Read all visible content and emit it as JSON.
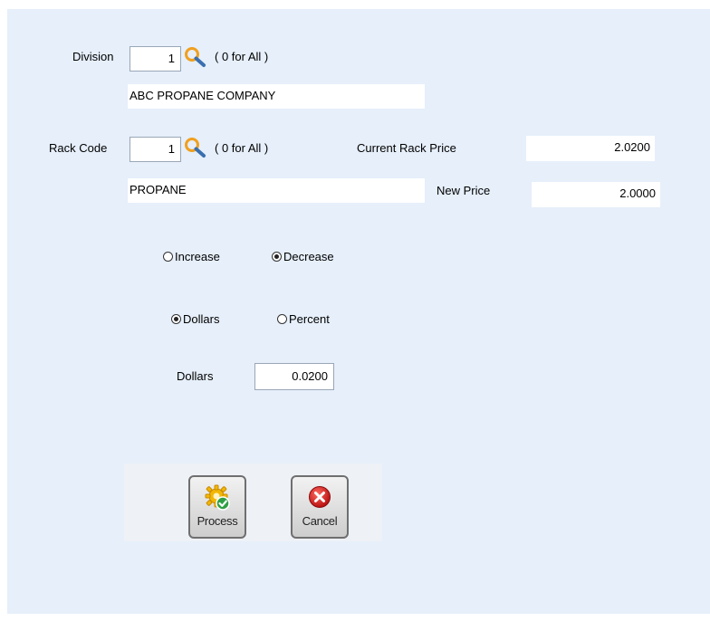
{
  "division": {
    "label": "Division",
    "value": "1",
    "hint": "( 0 for All )",
    "name": "ABC PROPANE COMPANY"
  },
  "rack_code": {
    "label": "Rack Code",
    "value": "1",
    "hint": "( 0 for All )",
    "name": "PROPANE"
  },
  "current_rack_price": {
    "label": "Current Rack Price",
    "value": "2.0200"
  },
  "new_price": {
    "label": "New Price",
    "value": "2.0000"
  },
  "direction": {
    "options": [
      "Increase",
      "Decrease"
    ],
    "selected": "Decrease"
  },
  "mode": {
    "options": [
      "Dollars",
      "Percent"
    ],
    "selected": "Dollars"
  },
  "amount": {
    "label": "Dollars",
    "value": "0.0200"
  },
  "buttons": {
    "process_label": "Process",
    "cancel_label": "Cancel"
  },
  "colors": {
    "panel_bg": "#e6effa",
    "search_icon": "#f0a020",
    "cancel_icon": "#d42020",
    "process_gear": "#f2b705",
    "process_check": "#2ea043"
  }
}
